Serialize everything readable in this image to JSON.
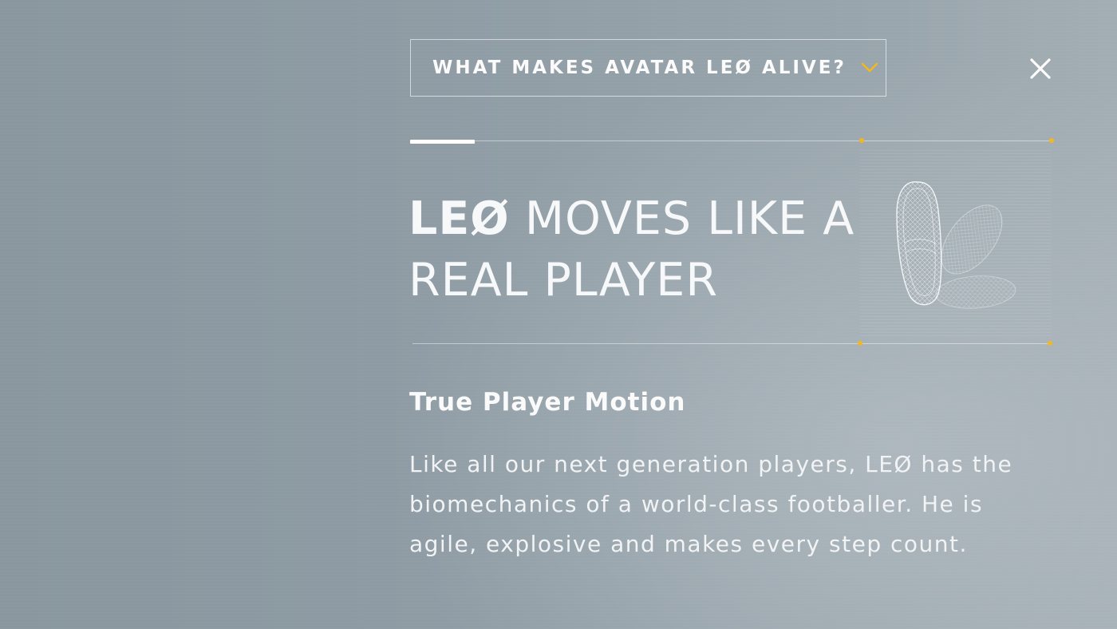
{
  "dropdown": {
    "label": "WHAT MAKES AVATAR LEØ ALIVE?",
    "icon": "chevron-down-icon"
  },
  "close": {
    "icon": "close-icon"
  },
  "headline": {
    "brand": "LEØ",
    "rest": " MOVES LIKE A REAL PLAYER"
  },
  "illustration": {
    "icon": "football-boots-wireframe"
  },
  "content": {
    "title": "True Player Motion",
    "body": "Like all our next generation players, LEØ has the biomechanics of a world-class footballer. He is agile, explosive and makes every step count."
  },
  "progress": {
    "fraction": 0.1
  },
  "colors": {
    "accent": "#f3b81c",
    "text": "#f7f8f9",
    "background": "#8f9ca4"
  }
}
